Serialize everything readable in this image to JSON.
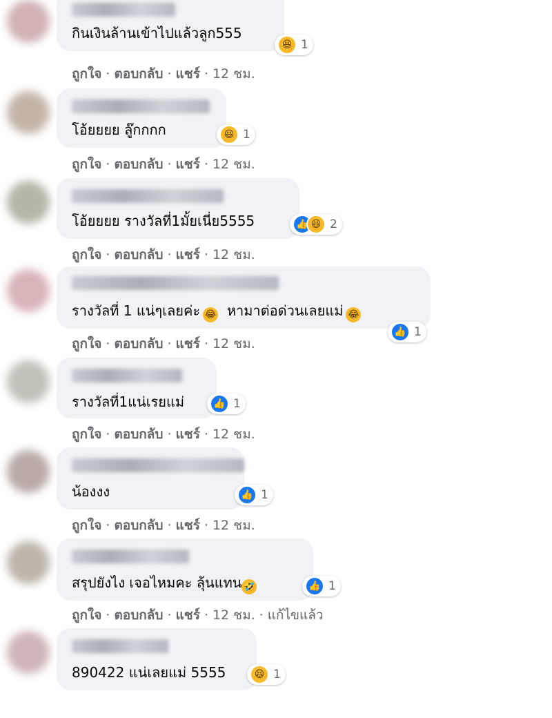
{
  "actions": {
    "like": "ถูกใจ",
    "reply": "ตอบกลับ",
    "share": "แชร์",
    "sep": "·"
  },
  "comments": [
    {
      "text": "กินเงินล้านเข้าไปแล้วลูก555",
      "reaction_count": "1",
      "time": "12 ชม."
    },
    {
      "text": "โอ้ยยยย ลู๊กกกก",
      "reaction_count": "1",
      "time": "12 ชม."
    },
    {
      "text": "โอ้ยยยย รางวัลที่1มั้ยเนี่ย5555",
      "reaction_count": "2",
      "time": "12 ชม."
    },
    {
      "text": "รางวัลที่ 1 แน่ๆเลยค่ะ",
      "text2": "หามาต่อด่วนเลยแม่",
      "reaction_count": "1",
      "time": "12 ชม."
    },
    {
      "text": "รางวัลที่1แน่เรยแม่",
      "reaction_count": "1",
      "time": "12 ชม."
    },
    {
      "text": "น้องงง",
      "reaction_count": "1",
      "time": "12 ชม."
    },
    {
      "text": "สรุปยังไง เจอไหมคะ ลุ้นแทน",
      "reaction_count": "1",
      "time": "12 ชม.",
      "edited": "แก้ไขแล้ว"
    },
    {
      "text": "890422 แน่เลยแม่ 5555",
      "reaction_count": "1"
    }
  ],
  "colors": {
    "bubble": "#f0f2f5",
    "like_blue": "#1877f2",
    "haha_yellow": "#f7b928",
    "meta_gray": "#65676b"
  },
  "icons": {
    "haha": "laughing-emoji",
    "like": "thumbs-up-icon",
    "tears": "tears-of-joy-emoji",
    "rofl": "rolling-laughing-emoji"
  }
}
